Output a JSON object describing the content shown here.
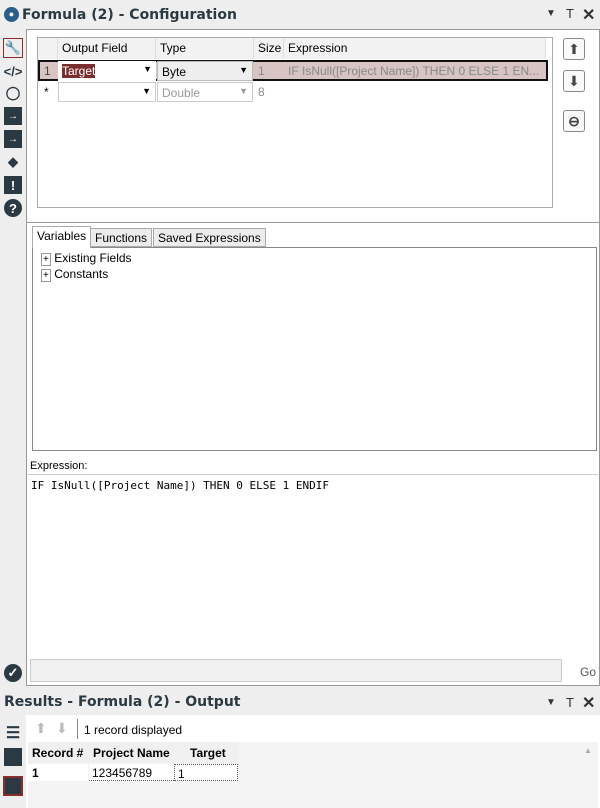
{
  "config": {
    "title": "Formula (2) - Configuration",
    "grid": {
      "headers": [
        "Output Field",
        "Type",
        "Size",
        "Expression"
      ],
      "rows": [
        {
          "num": "1",
          "field": "Target",
          "type": "Byte",
          "size": "1",
          "expression": "IF IsNull([Project Name]) THEN 0 ELSE 1 EN..."
        },
        {
          "num": "*",
          "field": "",
          "type": "Double",
          "size": "8",
          "expression": ""
        }
      ]
    },
    "tabs": [
      "Variables",
      "Functions",
      "Saved Expressions"
    ],
    "tree": [
      "Existing Fields",
      "Constants"
    ],
    "expression_label": "Expression:",
    "expression": "IF IsNull([Project Name]) THEN 0 ELSE 1 ENDIF",
    "go_label": "Go"
  },
  "results": {
    "title": "Results - Formula (2) - Output",
    "status": "1 record displayed",
    "headers": [
      "Record #",
      "Project Name",
      "Target"
    ],
    "rows": [
      [
        "1",
        "123456789",
        "1"
      ]
    ]
  },
  "colors": {
    "selected_row": "#d9c4c4",
    "selected_text_bg": "#7a2e2e",
    "accent_border": "#8b2d2d"
  }
}
